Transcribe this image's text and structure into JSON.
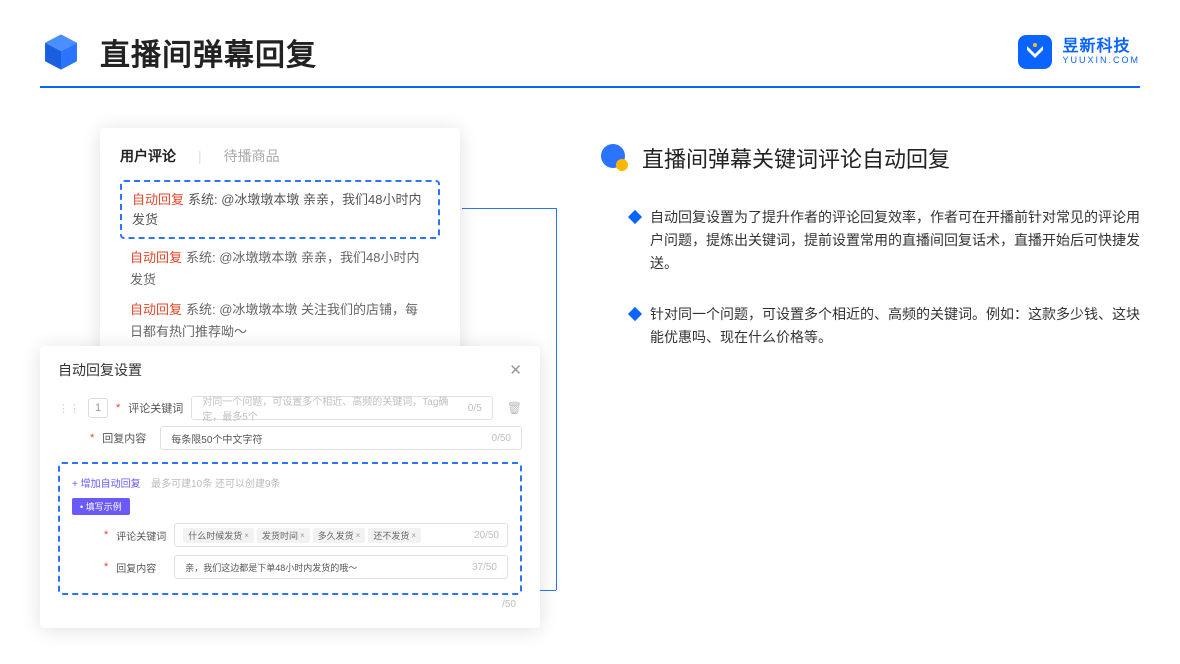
{
  "header": {
    "title": "直播间弹幕回复",
    "brand_cn": "昱新科技",
    "brand_en": "YUUXIN.COM"
  },
  "card1": {
    "tab_active": "用户评论",
    "tab_inactive": "待播商品",
    "row1_label": "自动回复",
    "row1_text": "系统: @冰墩墩本墩 亲亲，我们48小时内发货",
    "row2_label": "自动回复",
    "row2_text": "系统: @冰墩墩本墩 亲亲，我们48小时内发货",
    "row3_label": "自动回复",
    "row3_text": "系统: @冰墩墩本墩 关注我们的店铺，每日都有热门推荐呦～"
  },
  "card2": {
    "title": "自动回复设置",
    "idx": "1",
    "field1_label": "评论关键词",
    "field1_placeholder": "对同一个问题，可设置多个相近、高频的关键词，Tag确定，最多5个",
    "field1_counter": "0/5",
    "field2_label": "回复内容",
    "field2_placeholder": "每条限50个中文字符",
    "field2_counter": "0/50",
    "add_link": "+ 增加自动回复",
    "add_note": "最多可建10条 还可以创建9条",
    "example_badge": "• 填写示例",
    "ex_field1_label": "评论关键词",
    "ex_tags": [
      "什么时候发货",
      "发货时间",
      "多久发货",
      "还不发货"
    ],
    "ex_field1_counter": "20/50",
    "ex_field2_label": "回复内容",
    "ex_field2_text": "亲，我们这边都是下单48小时内发货的哦～",
    "ex_field2_counter": "37/50",
    "outer_counter": "/50"
  },
  "right": {
    "section_title": "直播间弹幕关键词评论自动回复",
    "bullet1": "自动回复设置为了提升作者的评论回复效率，作者可在开播前针对常见的评论用户问题，提炼出关键词，提前设置常用的直播间回复话术，直播开始后可快捷发送。",
    "bullet2": "针对同一个问题，可设置多个相近的、高频的关键词。例如：这款多少钱、这块能优惠吗、现在什么价格等。"
  }
}
